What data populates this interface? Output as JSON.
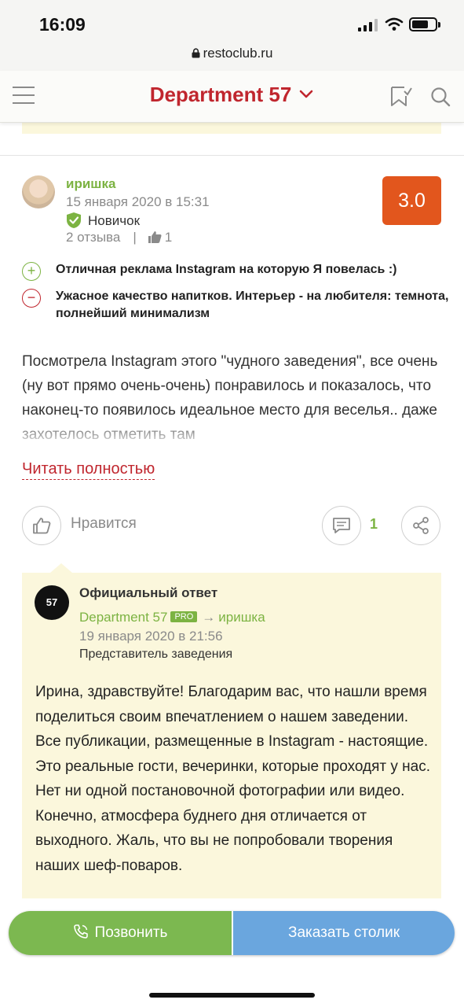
{
  "status_bar": {
    "time": "16:09",
    "url": "restoclub.ru"
  },
  "header": {
    "title": "Department 57"
  },
  "review": {
    "user_name": "иришка",
    "date": "15 января 2020 в 15:31",
    "level": "Новичок",
    "reviews_count": "2 отзыва",
    "likes_count": "1",
    "rating": "3.0",
    "pros": "Отличная реклама Instagram на которую Я повелась :)",
    "cons": "Ужасное качество напитков. Интерьер - на любителя: темнота, полнейший минимализм",
    "body": "Посмотрела Instagram этого \"чудного заведения\", все очень (ну вот прямо очень-очень) понравилось и показалось, что наконец-то появилось идеальное место для веселья.. даже захотелось отметить там",
    "read_more": "Читать полностью",
    "like_label": "Нравится",
    "comments_count": "1"
  },
  "reply": {
    "title": "Официальный ответ",
    "author": "Department 57",
    "pro_badge": "PRO",
    "arrow": "→",
    "to_user": "иришка",
    "date": "19 января 2020 в 21:56",
    "role": "Представитель заведения",
    "logo_text": "57",
    "text": "Ирина, здравствуйте! Благодарим вас, что нашли время поделиться своим впечатлением о нашем заведении. Все публикации, размещенные в Instagram - настоящие. Это реальные гости, вечеринки, которые проходят у нас. Нет ни одной постановочной фотографии или видео. Конечно, атмосфера буднего дня отличается от выходного. Жаль, что вы не попробовали творения наших шеф-поваров."
  },
  "buttons": {
    "call": "Позвонить",
    "book": "Заказать столик"
  },
  "colors": {
    "brand_red": "#c0262e",
    "green": "#7cb342",
    "rating_orange": "#e2561d",
    "call_green": "#7cb850",
    "book_blue": "#6aa6de",
    "reply_bg": "#fbf7dc"
  }
}
